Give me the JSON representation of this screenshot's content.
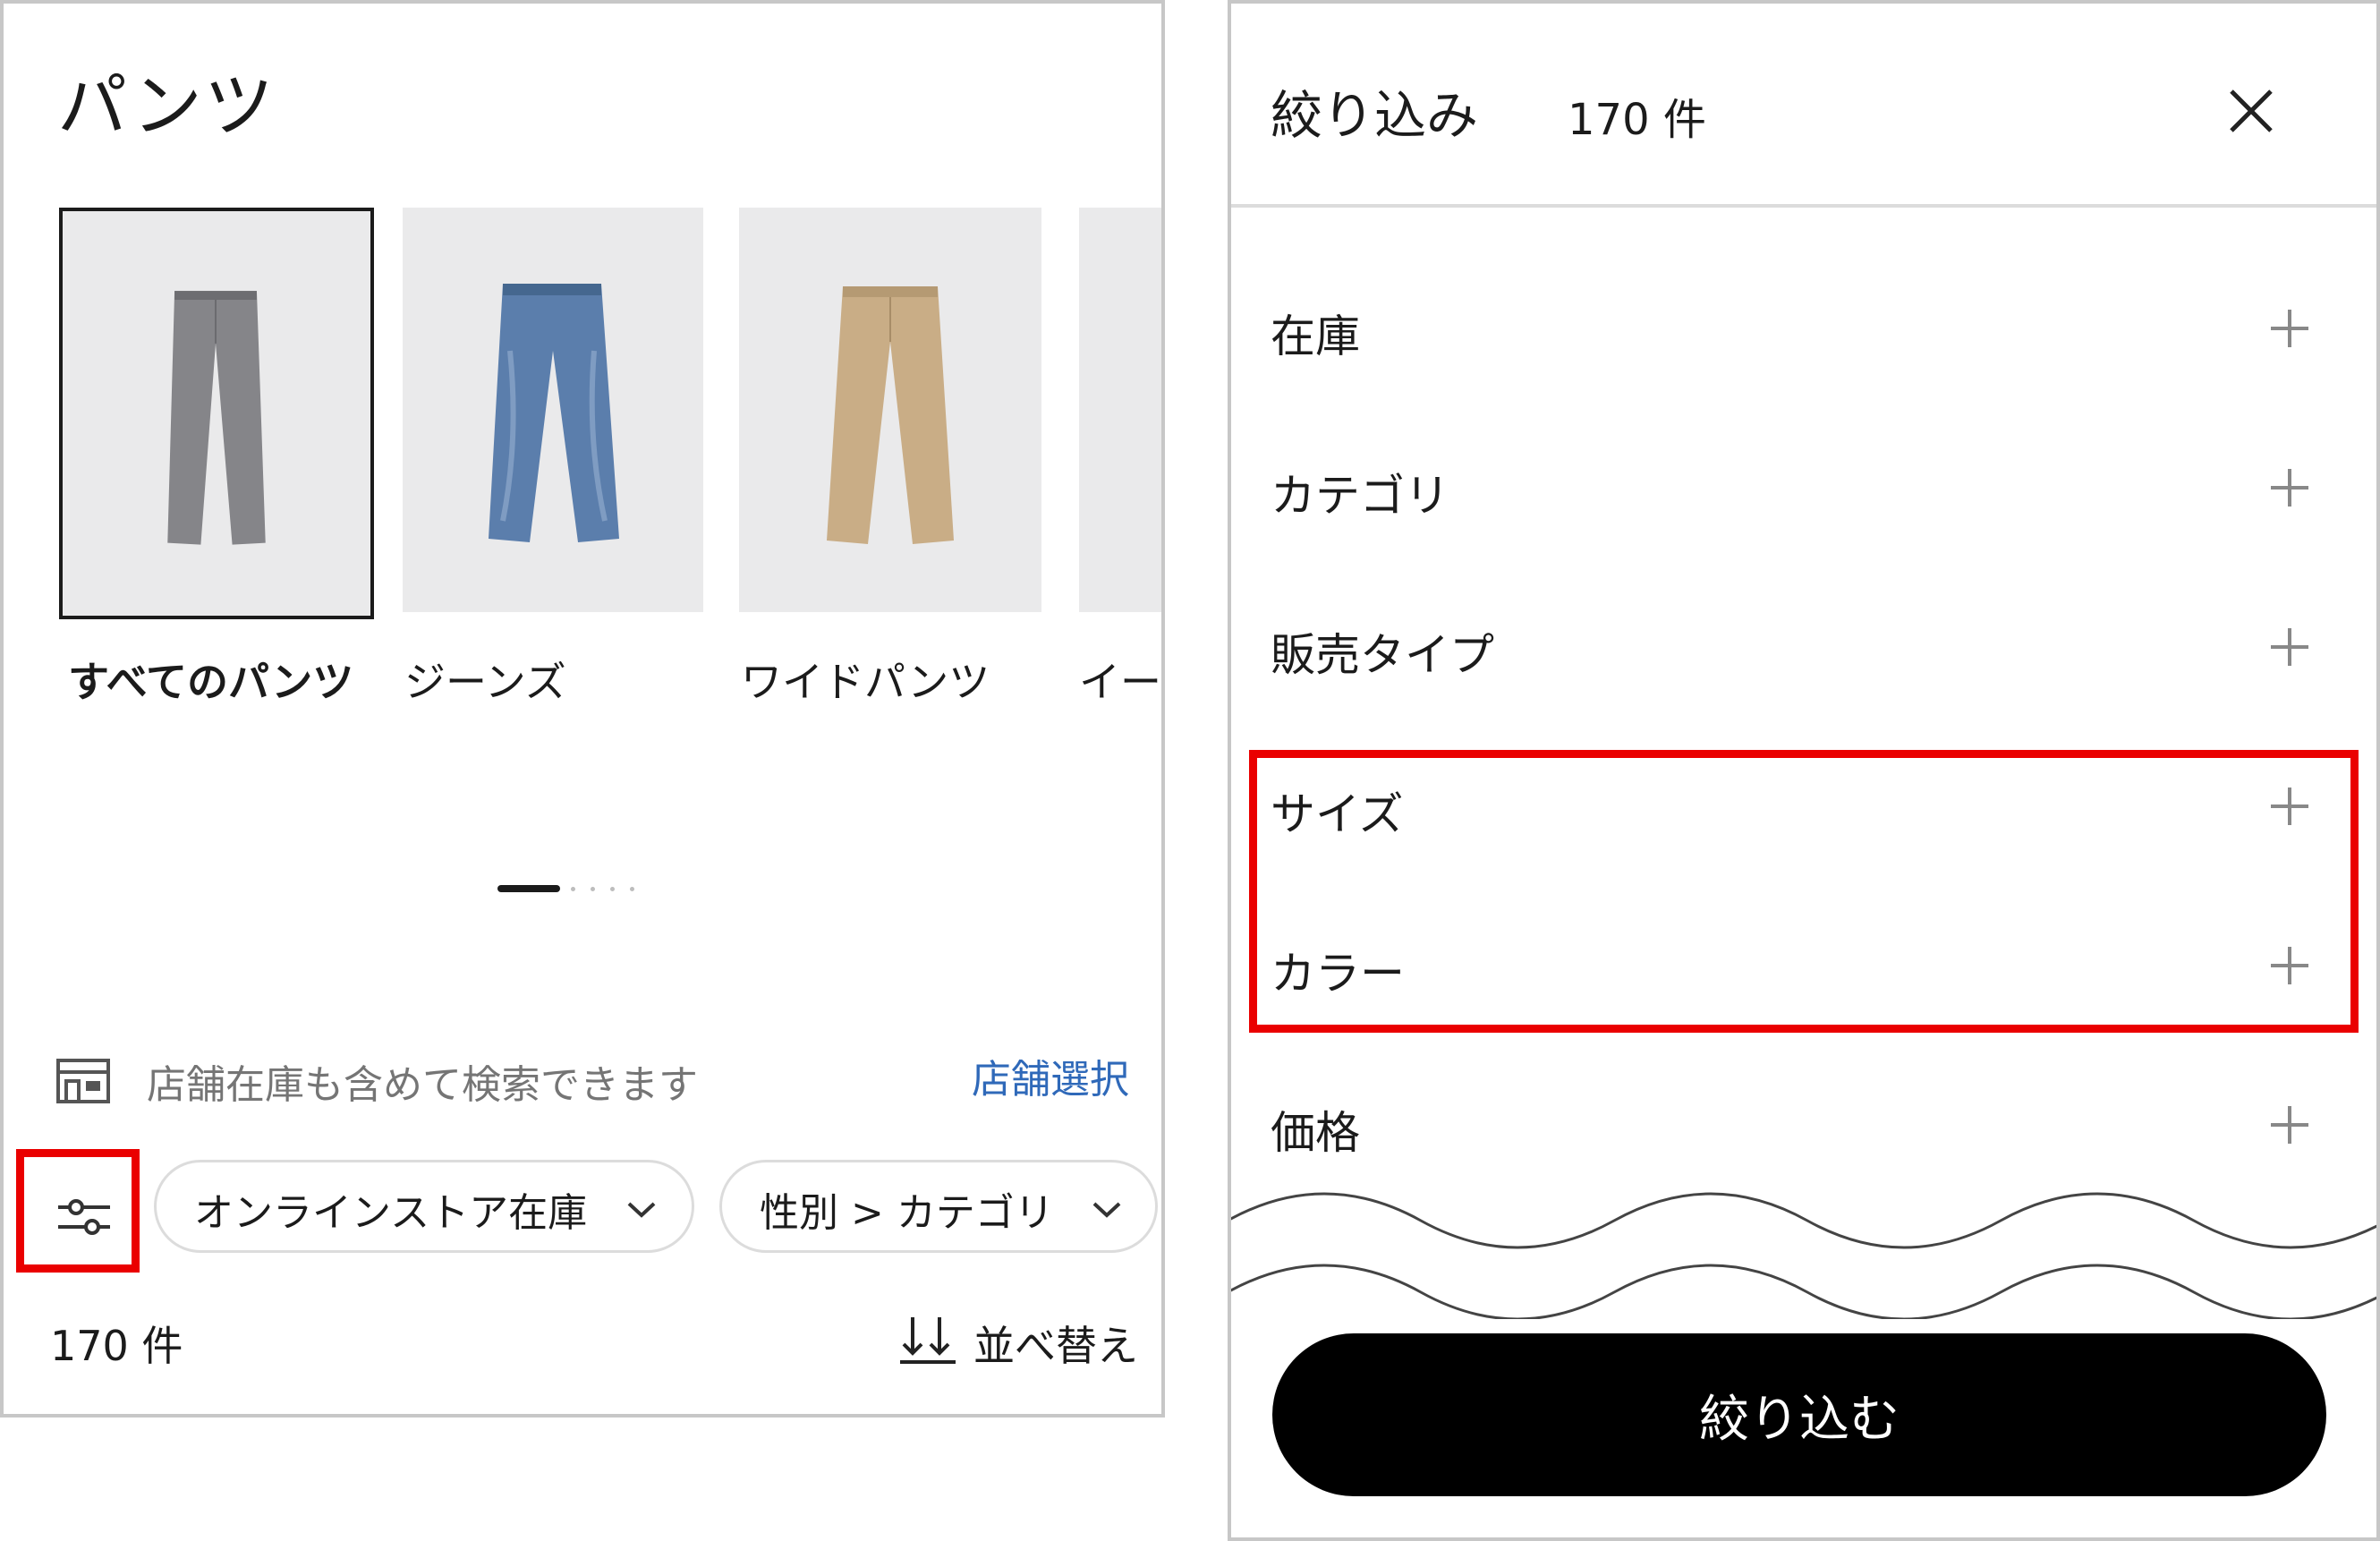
{
  "category_page": {
    "title": "パンツ",
    "categories": [
      {
        "label": "すべてのパンツ",
        "selected": true,
        "product_color": "#858589"
      },
      {
        "label": "ジーンズ",
        "selected": false,
        "product_color": "#5b7eac"
      },
      {
        "label": "ワイドパンツ",
        "selected": false,
        "product_color": "#c9ad86"
      },
      {
        "label": "イー",
        "selected": false,
        "product_color": "#eaeaeb"
      }
    ],
    "pager": {
      "total": 5,
      "current": 1
    },
    "store_stock": {
      "icon": "store-icon",
      "text": "店舗在庫も含めて検索できます",
      "link_label": "店舗選択"
    },
    "filter_button": {
      "icon": "filter-sliders-icon"
    },
    "chips": [
      {
        "label": "オンラインストア在庫",
        "icon": "chevron-down-icon"
      },
      {
        "label": "性別 > カテゴリ",
        "icon": "chevron-down-icon"
      }
    ],
    "result_count": "170 件",
    "sort": {
      "icon": "sort-icon",
      "label": "並べ替え"
    }
  },
  "filter_panel": {
    "title": "絞り込み",
    "count": "170 件",
    "close_icon": "close-icon",
    "filters": [
      {
        "label": "在庫",
        "icon": "plus-icon"
      },
      {
        "label": "カテゴリ",
        "icon": "plus-icon"
      },
      {
        "label": "販売タイプ",
        "icon": "plus-icon"
      },
      {
        "label": "サイズ",
        "icon": "plus-icon"
      },
      {
        "label": "カラー",
        "icon": "plus-icon"
      },
      {
        "label": "価格",
        "icon": "plus-icon"
      }
    ],
    "apply_label": "絞り込む"
  },
  "colors": {
    "accent_link": "#2f69b9",
    "highlight": "#ea0000",
    "button": "#000000",
    "card_bg": "#eaeaeb"
  }
}
